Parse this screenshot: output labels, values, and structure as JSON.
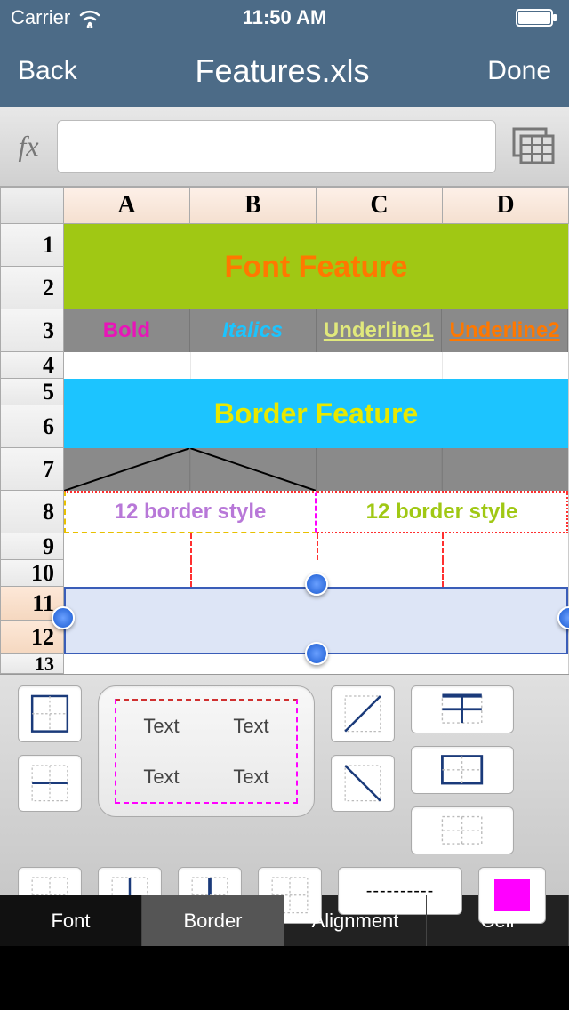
{
  "status": {
    "carrier": "Carrier",
    "time": "11:50 AM"
  },
  "nav": {
    "back": "Back",
    "title": "Features.xls",
    "done": "Done"
  },
  "formula": {
    "fx": "fx",
    "value": ""
  },
  "columns": [
    "A",
    "B",
    "C",
    "D"
  ],
  "rows": [
    "1",
    "2",
    "3",
    "4",
    "5",
    "6",
    "7",
    "8",
    "9",
    "10",
    "11",
    "12",
    "13"
  ],
  "cells": {
    "font_feature": "Font Feature",
    "bold": "Bold",
    "italics": "Italics",
    "underline1": "Underline1",
    "underline2": "Underline2",
    "border_feature": "Border Feature",
    "border_style_l": "12 border style",
    "border_style_r": "12 border style"
  },
  "preview": {
    "text": "Text"
  },
  "line_style": "----------",
  "tabs": {
    "font": "Font",
    "border": "Border",
    "alignment": "Alignment",
    "cell": "Cell"
  },
  "colors": {
    "accent": "#4c6b87",
    "magenta": "#ff00ff"
  }
}
